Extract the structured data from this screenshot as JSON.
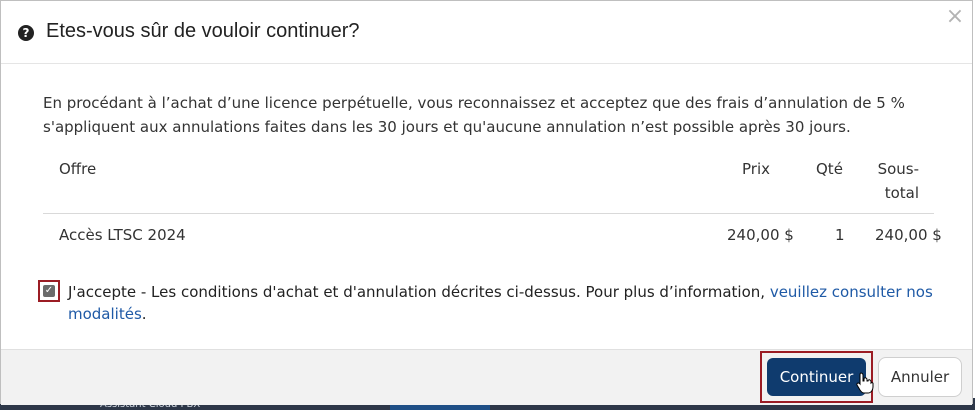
{
  "dialog": {
    "title": "Etes-vous sûr de vouloir continuer?",
    "close_glyph": "×",
    "help_glyph": "?",
    "message": "En procédant à l’achat d’une licence perpétuelle, vous reconnaissez et acceptez que des frais d’annulation de 5 % s'appliquent aux annulations faites dans les 30 jours et qu'aucune annulation n’est possible après 30 jours."
  },
  "table": {
    "headers": {
      "offre": "Offre",
      "prix": "Prix",
      "qte": "Qté",
      "sous_total": "Sous-total"
    },
    "rows": [
      {
        "offre": "Accès LTSC 2024",
        "prix": "240,00 $",
        "qte": "1",
        "sous_total": "240,00 $"
      }
    ]
  },
  "accept": {
    "checked": true,
    "check_glyph": "✓",
    "text": "J'accepte - Les conditions d'achat et d'annulation décrites ci-dessus. Pour plus d’information, ",
    "link_text": "veuillez consulter nos modalités",
    "after_link": "."
  },
  "footer": {
    "continue_label": "Continuer",
    "cancel_label": "Annuler"
  },
  "background": {
    "fragment_text": "Assistant Cloud PBX"
  },
  "colors": {
    "primary_button": "#0f3b6e",
    "link": "#1f5aa6",
    "highlight_border": "#9b1c24"
  }
}
